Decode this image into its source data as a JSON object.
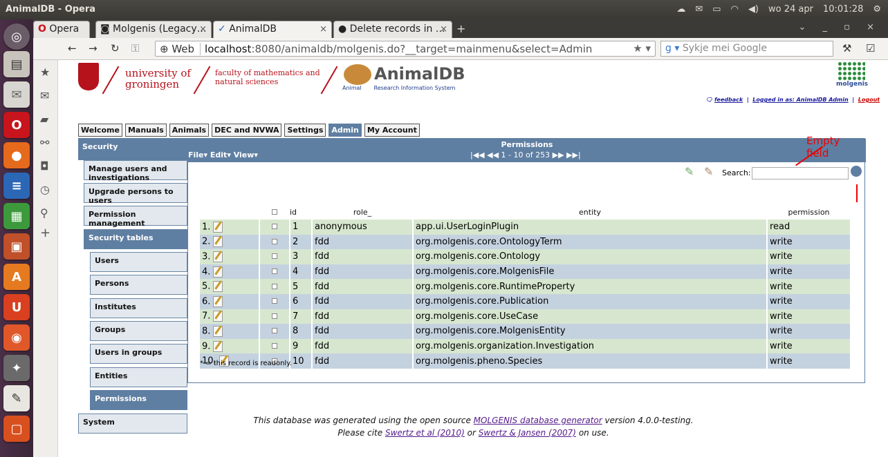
{
  "window_title": "AnimalDB - Opera",
  "tray": {
    "date": "wo 24 apr",
    "time": "10:01:28"
  },
  "tabs": [
    {
      "label": "Opera"
    },
    {
      "label": "Molgenis (Legacy…"
    },
    {
      "label": "AnimalDB"
    },
    {
      "label": "Delete records in …"
    }
  ],
  "nav": {
    "web_badge": "Web",
    "url_host": "localhost",
    "url_rest": ":8080/animaldb/molgenis.do?__target=mainmenu&select=Admin",
    "search_placeholder": "Sykje mei Google"
  },
  "header": {
    "univ_line1": "university of",
    "univ_line2": "groningen",
    "faculty_line1": "faculty of mathematics and",
    "faculty_line2": "natural sciences",
    "app_name": "AnimalDB",
    "app_sub_a": "Animal",
    "app_sub_b": "Research Information System",
    "molgenis": "molgenis",
    "feedback": "feedback",
    "logged_in": "Logged in as: AnimalDB Admin",
    "logout": "Logout"
  },
  "menu": [
    "Welcome",
    "Manuals",
    "Animals",
    "DEC and NVWA",
    "Settings",
    "Admin",
    "My Account"
  ],
  "left": {
    "security": "Security",
    "manage": "Manage users and investigations",
    "upgrade": "Upgrade persons to users",
    "perm_mgmt": "Permission management",
    "sec_tables": "Security tables",
    "users": "Users",
    "persons": "Persons",
    "institutes": "Institutes",
    "groups": "Groups",
    "users_in_groups": "Users in groups",
    "entities": "Entities",
    "permissions": "Permissions",
    "system": "System"
  },
  "main": {
    "title": "Permissions",
    "file": "File",
    "edit": "Edit",
    "view": "View",
    "pager": "1 - 10 of 253",
    "search_label": "Search:",
    "annotation": "Empty field",
    "readonly_note": "* = this record is readonly."
  },
  "table": {
    "headers": [
      "id",
      "role_",
      "entity",
      "permission"
    ],
    "rows": [
      {
        "n": "1.",
        "id": "1",
        "role": "anonymous",
        "entity": "app.ui.UserLoginPlugin",
        "perm": "read"
      },
      {
        "n": "2.",
        "id": "2",
        "role": "fdd",
        "entity": "org.molgenis.core.OntologyTerm",
        "perm": "write"
      },
      {
        "n": "3.",
        "id": "3",
        "role": "fdd",
        "entity": "org.molgenis.core.Ontology",
        "perm": "write"
      },
      {
        "n": "4.",
        "id": "4",
        "role": "fdd",
        "entity": "org.molgenis.core.MolgenisFile",
        "perm": "write"
      },
      {
        "n": "5.",
        "id": "5",
        "role": "fdd",
        "entity": "org.molgenis.core.RuntimeProperty",
        "perm": "write"
      },
      {
        "n": "6.",
        "id": "6",
        "role": "fdd",
        "entity": "org.molgenis.core.Publication",
        "perm": "write"
      },
      {
        "n": "7.",
        "id": "7",
        "role": "fdd",
        "entity": "org.molgenis.core.UseCase",
        "perm": "write"
      },
      {
        "n": "8.",
        "id": "8",
        "role": "fdd",
        "entity": "org.molgenis.core.MolgenisEntity",
        "perm": "write"
      },
      {
        "n": "9.",
        "id": "9",
        "role": "fdd",
        "entity": "org.molgenis.organization.Investigation",
        "perm": "write"
      },
      {
        "n": "10.",
        "id": "10",
        "role": "fdd",
        "entity": "org.molgenis.pheno.Species",
        "perm": "write"
      }
    ]
  },
  "footer": {
    "l1a": "This database was generated using the open source",
    "l1link": "MOLGENIS database generator",
    "l1b": "version 4.0.0-testing.",
    "l2a": "Please cite",
    "l2link1": "Swertz et al (2010)",
    "l2or": "or",
    "l2link2": "Swertz & Jansen (2007)",
    "l2b": "on use."
  }
}
